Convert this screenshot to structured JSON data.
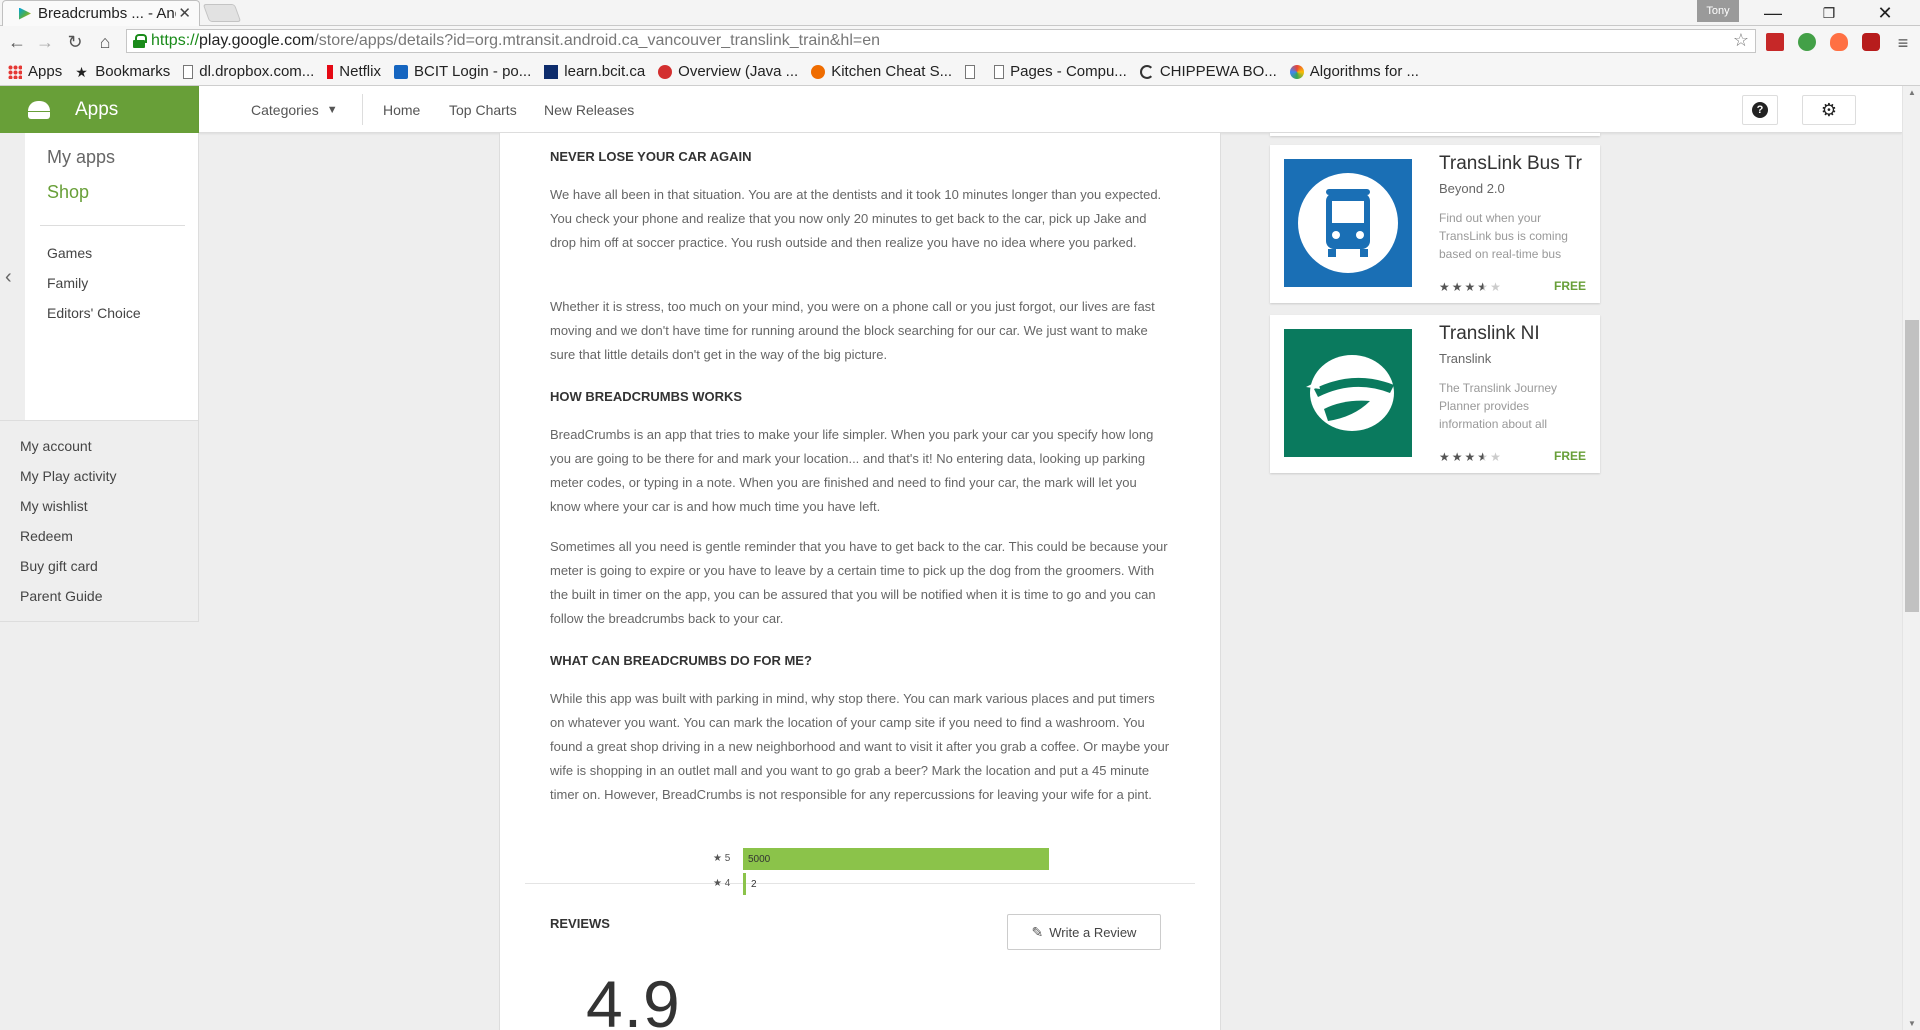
{
  "browser": {
    "tab_title": "Breadcrumbs ... - And",
    "tab_close": "✕",
    "profile_name": "Tony",
    "url_scheme": "https://",
    "url_host": "play.google.com",
    "url_rest": "/store/apps/details?id=org.mtransit.android.ca_vancouver_translink_train&hl=en",
    "bookmarks": [
      {
        "label": "Apps",
        "icon": "apps-grid-icon"
      },
      {
        "label": "Bookmarks",
        "icon": "star-icon"
      },
      {
        "label": "dl.dropbox.com...",
        "icon": "page-icon"
      },
      {
        "label": "Netflix",
        "icon": "netflix-icon"
      },
      {
        "label": "BCIT Login - po...",
        "icon": "bcit-icon"
      },
      {
        "label": "learn.bcit.ca",
        "icon": "bcit-learn-icon"
      },
      {
        "label": "Overview (Java ...",
        "icon": "java-icon"
      },
      {
        "label": "Kitchen Cheat S...",
        "icon": "kitchen-icon"
      },
      {
        "label": "",
        "icon": "page-icon"
      },
      {
        "label": "Pages - Compu...",
        "icon": "page-icon"
      },
      {
        "label": "CHIPPEWA BO...",
        "icon": "c-icon"
      },
      {
        "label": "Algorithms for ...",
        "icon": "algorithms-icon"
      }
    ]
  },
  "header": {
    "brand": "Apps",
    "categories": "Categories",
    "home": "Home",
    "top_charts": "Top Charts",
    "new_releases": "New Releases",
    "help_glyph": "?"
  },
  "sidebar": {
    "my_apps": "My apps",
    "shop": "Shop",
    "sub_items": [
      "Games",
      "Family",
      "Editors' Choice"
    ],
    "account_items": [
      "My account",
      "My Play activity",
      "My wishlist",
      "Redeem",
      "Buy gift card",
      "Parent Guide"
    ]
  },
  "description": {
    "heading1": "NEVER LOSE YOUR CAR AGAIN",
    "para1": "We have all been in that situation. You are at the dentists and it took 10 minutes longer than you expected. You check your phone and realize that you now only 20 minutes to get back to the car, pick up Jake and drop him off at soccer practice. You rush outside and then realize you have no idea where you parked.",
    "para2": "Whether it is stress, too much on your mind, you were on a phone call or you just forgot, our lives are fast moving and we don't have time for running around the block searching for our car. We just want to make sure that little details don't get in the way of the big picture.",
    "heading2": "HOW BREADCRUMBS WORKS",
    "para3": "BreadCrumbs is an app that tries to make your life simpler. When you park your car you specify how long you are going to be there for and mark your location... and that's it! No entering data, looking up parking meter codes, or typing in a note. When you are finished and need to find your car, the mark will let you know where your car is and how much time you have left.",
    "para4": "Sometimes all you need is gentle reminder that you have to get back to the car. This could be because your meter is going to expire or you have to leave by a certain time to pick up the dog from the groomers. With the built in timer on the app, you can be assured that you will be notified when it is time to go and you can follow the breadcrumbs back to your car.",
    "heading3": "WHAT CAN BREADCRUMBS DO FOR ME?",
    "para5": "While this app was built with parking in mind, why stop there. You can mark various places and put timers on whatever you want. You can mark the location of your camp site if you need to find a washroom. You found a great shop driving in a new neighborhood and want to visit it after you grab a coffee. Or maybe your wife is shopping in an outlet mall and you want to go grab a beer? Mark the location and put a 45 minute timer on. However, BreadCrumbs is not responsible for any repercussions for leaving your wife for a pint."
  },
  "reviews": {
    "title": "REVIEWS",
    "write_button": "Write a Review",
    "average": "4.9",
    "histogram": [
      {
        "label": "★ 5",
        "count": "5000",
        "fraction": 1.0
      },
      {
        "label": "★ 4",
        "count": "2",
        "fraction": 0.0
      }
    ]
  },
  "similar_apps": [
    {
      "title": "TransLink Bus Tr",
      "developer": "Beyond 2.0",
      "description": "Find out when your TransLink bus is coming based on real-time bus",
      "rating": 3.5,
      "price": "FREE",
      "icon": "bus-icon",
      "color": "#1a6fb5"
    },
    {
      "title": "Translink NI",
      "developer": "Translink",
      "description": "The Translink Journey Planner provides information about all",
      "rating": 3.5,
      "price": "FREE",
      "icon": "translink-ni-icon",
      "color": "#0a7a5e"
    }
  ],
  "colors": {
    "accent_green": "#689f38",
    "bar_green": "#8bc34a"
  }
}
